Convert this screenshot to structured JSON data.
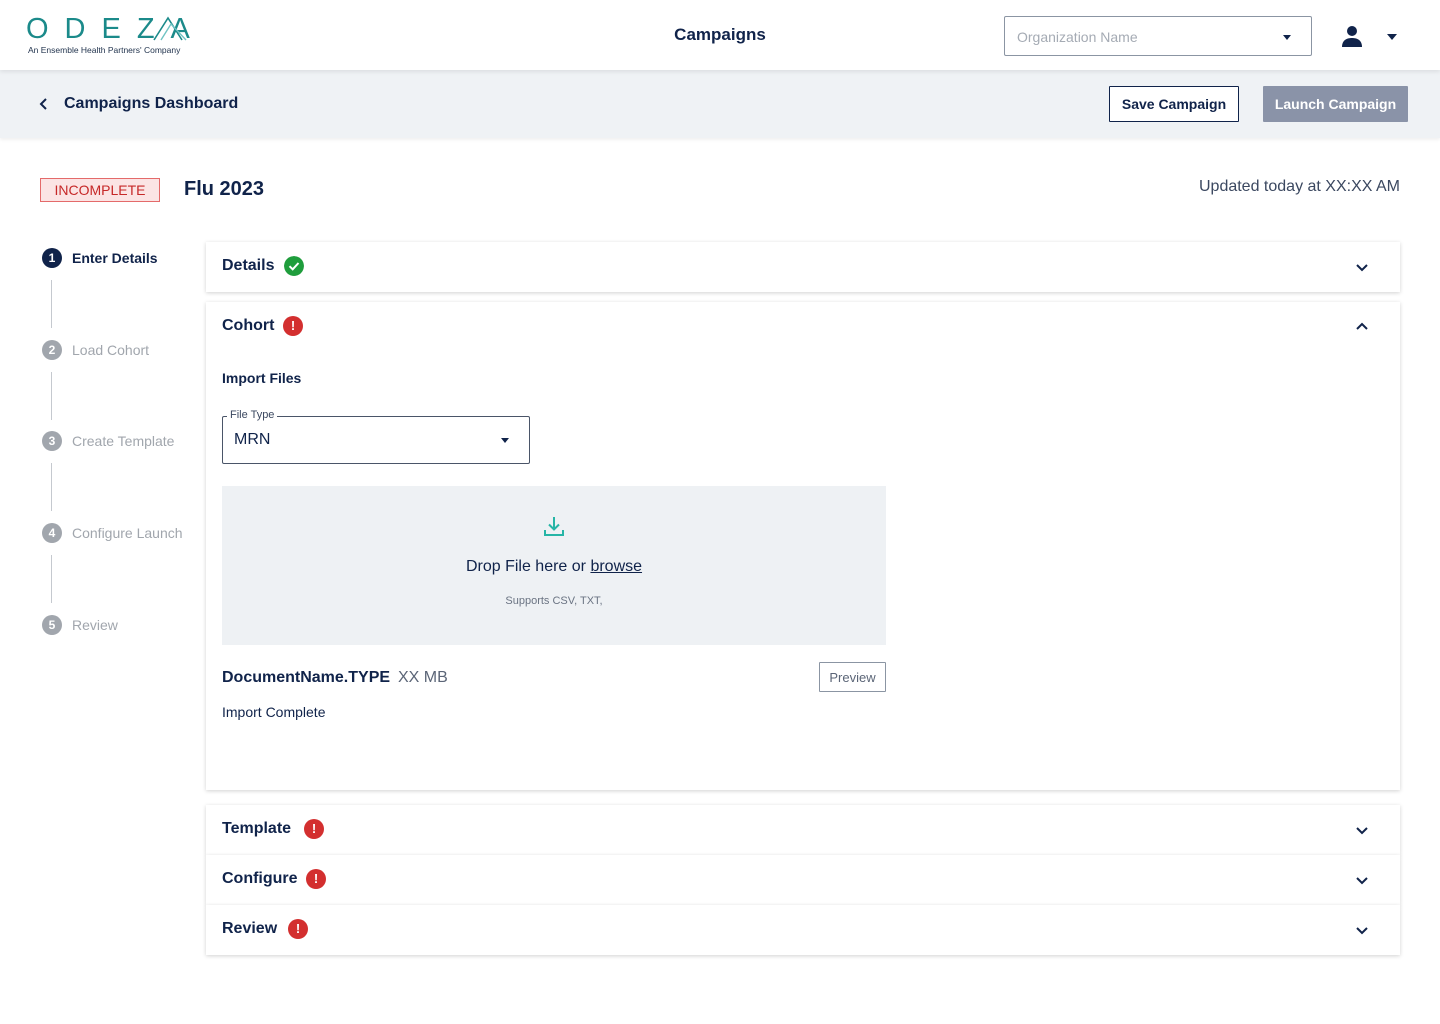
{
  "header": {
    "logo_word": "ODEZA",
    "logo_tagline": "An Ensemble Health Partners' Company",
    "title": "Campaigns",
    "org_select": {
      "placeholder": "Organization Name"
    },
    "user_icon": "user-icon"
  },
  "subheader": {
    "back_label": "Campaigns Dashboard",
    "save_label": "Save Campaign",
    "launch_label": "Launch Campaign"
  },
  "campaign": {
    "status": "INCOMPLETE",
    "name": "Flu 2023",
    "updated": "Updated today at XX:XX AM"
  },
  "steps": [
    {
      "num": "1",
      "label": "Enter Details",
      "active": true
    },
    {
      "num": "2",
      "label": "Load Cohort",
      "active": false
    },
    {
      "num": "3",
      "label": "Create Template",
      "active": false
    },
    {
      "num": "4",
      "label": "Configure Launch",
      "active": false
    },
    {
      "num": "5",
      "label": "Review",
      "active": false
    }
  ],
  "panels": {
    "details": {
      "title": "Details",
      "status": "complete"
    },
    "cohort": {
      "title": "Cohort",
      "status": "error",
      "expanded": true,
      "import_label": "Import Files",
      "file_type": {
        "legend": "File Type",
        "value": "MRN"
      },
      "dropzone": {
        "text": "Drop File here or ",
        "link": "browse",
        "sub": "Supports CSV, TXT,"
      },
      "file": {
        "name": "DocumentName.TYPE",
        "size": "XX MB",
        "preview_label": "Preview",
        "status": "Import Complete"
      }
    },
    "template": {
      "title": "Template",
      "status": "error"
    },
    "configure": {
      "title": "Configure",
      "status": "error"
    },
    "review": {
      "title": "Review",
      "status": "error"
    }
  },
  "colors": {
    "navy": "#10234a",
    "teal": "#1b8a8a",
    "success": "#1f9d3c",
    "error": "#d32f2f",
    "disabled_button": "#8a93a8",
    "subheader_bg": "#eff2f5"
  },
  "icons": {
    "error_glyph": "!"
  }
}
